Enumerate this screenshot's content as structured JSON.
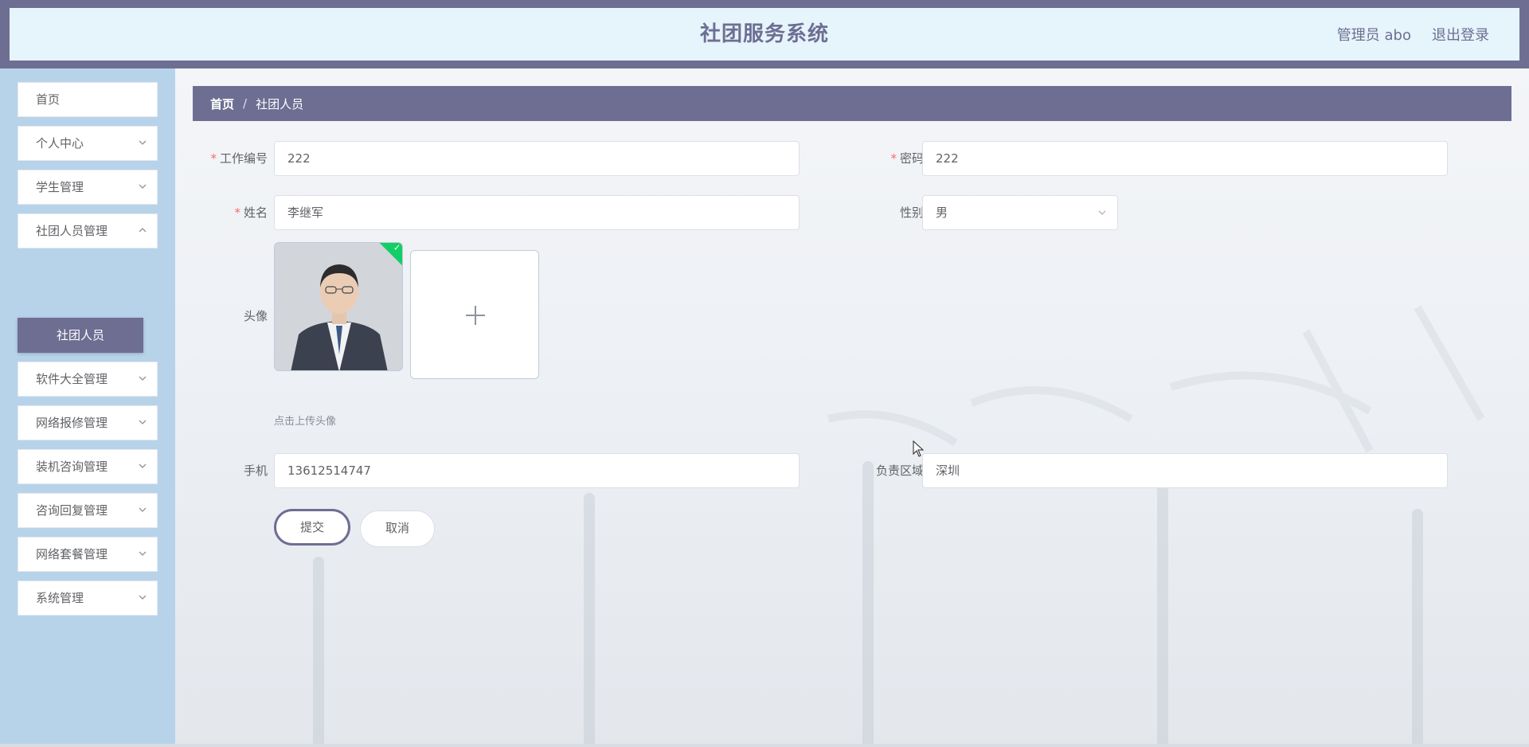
{
  "header": {
    "title": "社团服务系统",
    "user_label": "管理员 abo",
    "logout_label": "退出登录"
  },
  "sidebar": {
    "items": [
      {
        "label": "首页"
      },
      {
        "label": "个人中心"
      },
      {
        "label": "学生管理"
      },
      {
        "label": "社团人员管理"
      },
      {
        "label": "软件大全管理"
      },
      {
        "label": "网络报修管理"
      },
      {
        "label": "装机咨询管理"
      },
      {
        "label": "咨询回复管理"
      },
      {
        "label": "网络套餐管理"
      },
      {
        "label": "系统管理"
      }
    ],
    "active_sub_item": "社团人员"
  },
  "breadcrumb": {
    "home": "首页",
    "separator": "/",
    "current": "社团人员"
  },
  "form": {
    "work_id": {
      "label": "工作编号",
      "value": "222"
    },
    "password": {
      "label": "密码",
      "value": "222"
    },
    "name": {
      "label": "姓名",
      "value": "李继军"
    },
    "gender": {
      "label": "性别",
      "value": "男"
    },
    "avatar": {
      "label": "头像",
      "tip": "点击上传头像"
    },
    "phone": {
      "label": "手机",
      "value": "13612514747"
    },
    "region": {
      "label": "负责区域",
      "value": "深圳"
    },
    "required_mark": "*",
    "submit_label": "提交",
    "cancel_label": "取消"
  },
  "colors": {
    "primary": "#6e6e93",
    "header_bg": "#e6f4fb",
    "sidebar_bg": "#b7d3ea",
    "required": "#f56c6c",
    "success": "#13ce66"
  }
}
